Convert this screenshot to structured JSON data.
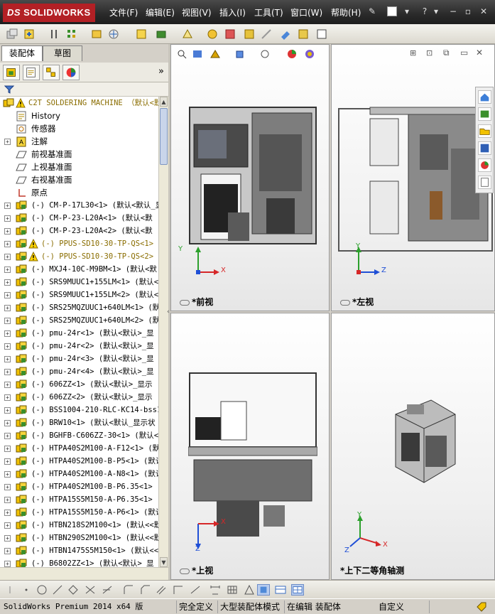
{
  "app": {
    "logo_text": "SOLIDWORKS",
    "logo_prefix": "DS"
  },
  "menu": {
    "items": [
      "文件(F)",
      "编辑(E)",
      "视图(V)",
      "插入(I)",
      "工具(T)",
      "窗口(W)",
      "帮助(H)"
    ]
  },
  "left_panel": {
    "tabs": [
      "装配体",
      "草图"
    ],
    "tree": {
      "root": "C2T SOLDERING MACHINE （默认<默",
      "items": [
        {
          "label": "History",
          "type": "history"
        },
        {
          "label": "传感器",
          "type": "sensor"
        },
        {
          "label": "注解",
          "type": "annotation",
          "expandable": true
        },
        {
          "label": "前视基准面",
          "type": "plane"
        },
        {
          "label": "上视基准面",
          "type": "plane"
        },
        {
          "label": "右视基准面",
          "type": "plane"
        },
        {
          "label": "原点",
          "type": "origin"
        },
        {
          "label": "(-) CM-P-17L30<1> (默认<默认_显",
          "type": "part",
          "expandable": true
        },
        {
          "label": "(-) CM-P-23-L20A<1> (默认<默",
          "type": "part",
          "expandable": true
        },
        {
          "label": "(-) CM-P-23-L20A<2> (默认<默",
          "type": "part",
          "expandable": true
        },
        {
          "label": "(-) PPUS-SD10-30-TP-QS<1> (",
          "type": "part-warning",
          "expandable": true
        },
        {
          "label": "(-) PPUS-SD10-30-TP-QS<2> (",
          "type": "part-warning",
          "expandable": true
        },
        {
          "label": "(-) MXJ4-10C-M9BM<1> (默认<默",
          "type": "part",
          "expandable": true
        },
        {
          "label": "(-) SRS9MUUC1+155LM<1> (默认<",
          "type": "part",
          "expandable": true
        },
        {
          "label": "(-) SRS9MUUC1+155LM<2> (默认<",
          "type": "part",
          "expandable": true
        },
        {
          "label": "(-) SRS25MQZUUC1+640LM<1> (默",
          "type": "part",
          "expandable": true
        },
        {
          "label": "(-) SRS25MQZUUC1+640LM<2> (默",
          "type": "part",
          "expandable": true
        },
        {
          "label": "(-) pmu-24r<1> (默认<默认>_显",
          "type": "part",
          "expandable": true
        },
        {
          "label": "(-) pmu-24r<2> (默认<默认>_显",
          "type": "part",
          "expandable": true
        },
        {
          "label": "(-) pmu-24r<3> (默认<默认>_显",
          "type": "part",
          "expandable": true
        },
        {
          "label": "(-) pmu-24r<4> (默认<默认>_显",
          "type": "part",
          "expandable": true
        },
        {
          "label": "(-) 606ZZ<1> (默认<默认>_显示",
          "type": "part",
          "expandable": true
        },
        {
          "label": "(-) 606ZZ<2> (默认<默认>_显示",
          "type": "part",
          "expandable": true
        },
        {
          "label": "(-) BSS1004-210-RLC-KC14-bss1",
          "type": "part",
          "expandable": true
        },
        {
          "label": "(-) BRW10<1> (默认<默认_显示状",
          "type": "part",
          "expandable": true
        },
        {
          "label": "(-) BGHFB-C606ZZ-30<1> (默认<",
          "type": "part",
          "expandable": true
        },
        {
          "label": "(-) HTPA40S2M100-A-F12<1> (默",
          "type": "part",
          "expandable": true
        },
        {
          "label": "(-) HTPA40S2M100-B-P5<1> (默认",
          "type": "part",
          "expandable": true
        },
        {
          "label": "(-) HTPA40S2M100-A-N8<1> (默认",
          "type": "part",
          "expandable": true
        },
        {
          "label": "(-) HTPA40S2M100-B-P6.35<1> (",
          "type": "part",
          "expandable": true
        },
        {
          "label": "(-) HTPA15S5M150-A-P6.35<1> (",
          "type": "part",
          "expandable": true
        },
        {
          "label": "(-) HTPA15S5M150-A-P6<1> (默认",
          "type": "part",
          "expandable": true
        },
        {
          "label": "(-) HTBN218S2M100<1> (默认<<默",
          "type": "part",
          "expandable": true
        },
        {
          "label": "(-) HTBN290S2M100<1> (默认<<默",
          "type": "part",
          "expandable": true
        },
        {
          "label": "(-) HTBN1475S5M150<1> (默认<<默",
          "type": "part",
          "expandable": true
        },
        {
          "label": "(-) B6802ZZ<1> (默认<默认>_显",
          "type": "part",
          "expandable": true
        }
      ]
    }
  },
  "viewports": {
    "front": {
      "label": "*前视",
      "axis_x": "X",
      "axis_y": "Y"
    },
    "left": {
      "label": "*左视",
      "axis_z": "Z",
      "axis_y": "Y"
    },
    "top": {
      "label": "*上视",
      "axis_x": "X",
      "axis_z": "Z"
    },
    "iso": {
      "label": "*上下二等角轴测",
      "axis_x": "X",
      "axis_y": "Y",
      "axis_z": "Z"
    }
  },
  "status_bar": {
    "app_version": "SolidWorks Premium 2014 x64 版",
    "fully_defined": "完全定义",
    "large_assembly_mode": "大型装配体模式",
    "editing": "在编辑 装配体",
    "custom": "自定义"
  },
  "colors": {
    "accent_red": "#b32025",
    "part_yellow": "#f2c200",
    "axis_x": "#d62728",
    "axis_y": "#2ca02c",
    "axis_z": "#1f4fd6"
  }
}
